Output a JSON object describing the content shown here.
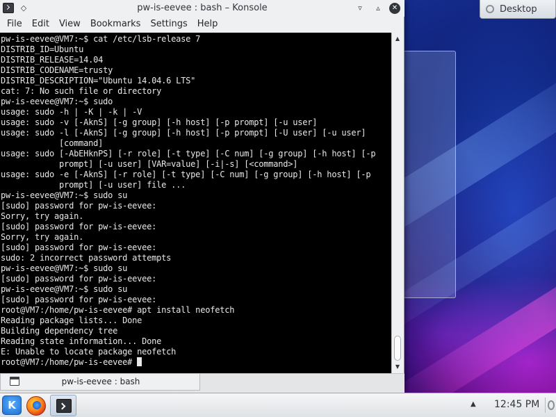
{
  "window": {
    "title": "pw-is-eevee : bash – Konsole",
    "pin_glyph": "◇",
    "minimize_glyph": "▿",
    "maximize_glyph": "▵",
    "close_glyph": "✕"
  },
  "menu": [
    "File",
    "Edit",
    "View",
    "Bookmarks",
    "Settings",
    "Help"
  ],
  "terminal": {
    "lines": [
      "pw-is-eevee@VM7:~$ cat /etc/lsb-release 7",
      "DISTRIB_ID=Ubuntu",
      "DISTRIB_RELEASE=14.04",
      "DISTRIB_CODENAME=trusty",
      "DISTRIB_DESCRIPTION=\"Ubuntu 14.04.6 LTS\"",
      "cat: 7: No such file or directory",
      "pw-is-eevee@VM7:~$ sudo",
      "usage: sudo -h | -K | -k | -V",
      "usage: sudo -v [-AknS] [-g group] [-h host] [-p prompt] [-u user]",
      "usage: sudo -l [-AknS] [-g group] [-h host] [-p prompt] [-U user] [-u user]",
      "            [command]",
      "usage: sudo [-AbEHknPS] [-r role] [-t type] [-C num] [-g group] [-h host] [-p",
      "            prompt] [-u user] [VAR=value] [-i|-s] [<command>]",
      "usage: sudo -e [-AknS] [-r role] [-t type] [-C num] [-g group] [-h host] [-p",
      "            prompt] [-u user] file ...",
      "pw-is-eevee@VM7:~$ sudo su",
      "[sudo] password for pw-is-eevee:",
      "Sorry, try again.",
      "[sudo] password for pw-is-eevee:",
      "Sorry, try again.",
      "[sudo] password for pw-is-eevee:",
      "sudo: 2 incorrect password attempts",
      "pw-is-eevee@VM7:~$ sudo su",
      "[sudo] password for pw-is-eevee:",
      "pw-is-eevee@VM7:~$ sudo su",
      "[sudo] password for pw-is-eevee:",
      "root@VM7:/home/pw-is-eevee# apt install neofetch",
      "Reading package lists... Done",
      "Building dependency tree",
      "Reading state information... Done",
      "E: Unable to locate package neofetch"
    ],
    "prompt": "root@VM7:/home/pw-is-eevee# "
  },
  "scrollbar": {
    "up_glyph": "▲",
    "down_glyph": "▼",
    "position_fraction": 1.0
  },
  "tab": {
    "label": "pw-is-eevee : bash"
  },
  "desktop": {
    "button_label": "Desktop"
  },
  "taskbar": {
    "kickoff_glyph": "K",
    "tray_arrow_glyph": "▲",
    "clock": "12:45 PM"
  },
  "colors": {
    "terminal_bg": "#000000",
    "terminal_fg": "#e8e8e8",
    "window_chrome": "#eff0f1"
  },
  "icons": {
    "app": "konsole-icon",
    "launcher": "kde-kickoff-icon",
    "browser": "firefox-icon",
    "tray": "plasma-cashew-icon"
  }
}
